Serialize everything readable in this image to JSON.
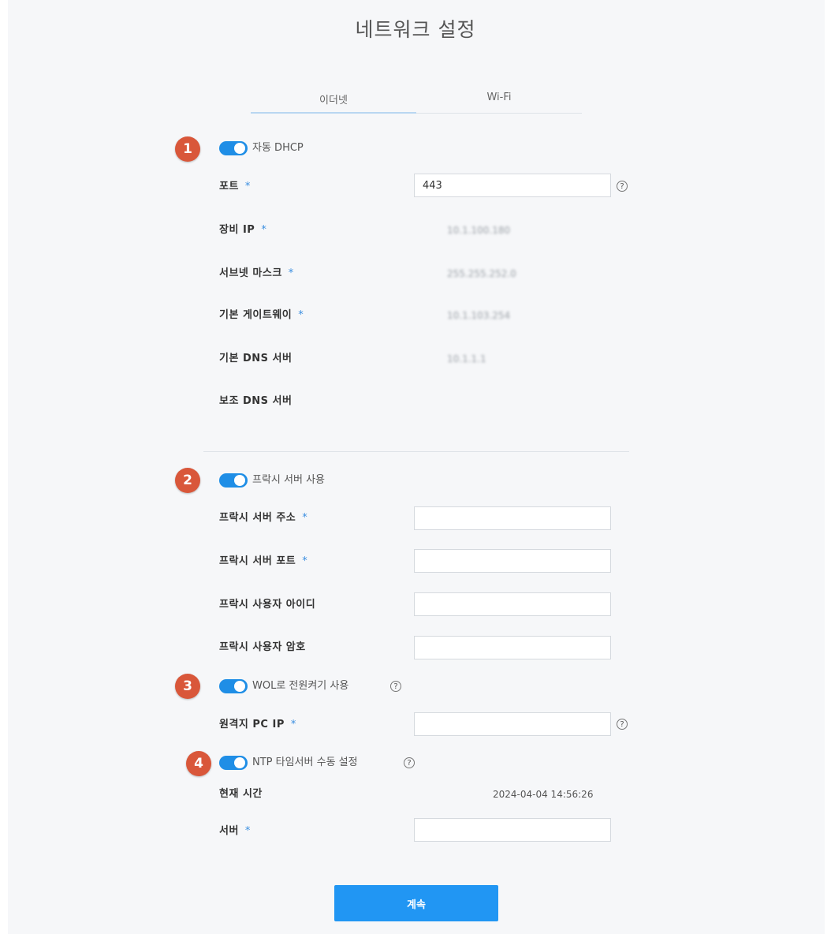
{
  "page_title": "네트워크 설정",
  "tabs": [
    {
      "label": "이더넷",
      "active": true
    },
    {
      "label": "Wi-Fi",
      "active": false
    }
  ],
  "accent_color": "#1f8ee6",
  "badge_color": "#d9573a",
  "required_mark": "*",
  "help_glyph": "?",
  "icons": {
    "help": "question-circle-icon",
    "toggle": "toggle-switch-on"
  },
  "section1": {
    "badge": "1",
    "toggle_label": "자동 DHCP",
    "toggle_on": true,
    "port": {
      "label": "포트",
      "value": "443"
    },
    "device_ip": {
      "label": "장비 IP",
      "value": "10.1.100.180"
    },
    "subnet_mask": {
      "label": "서브넷 마스크",
      "value": "255.255.252.0"
    },
    "gateway": {
      "label": "기본 게이트웨이",
      "value": "10.1.103.254"
    },
    "dns1": {
      "label": "기본 DNS 서버",
      "value": "10.1.1.1"
    },
    "dns2": {
      "label": "보조 DNS 서버",
      "value": ""
    }
  },
  "section2": {
    "badge": "2",
    "toggle_label": "프락시 서버 사용",
    "toggle_on": true,
    "proxy_address": {
      "label": "프락시 서버 주소",
      "value": ""
    },
    "proxy_port": {
      "label": "프락시 서버 포트",
      "value": ""
    },
    "proxy_user": {
      "label": "프락시 사용자 아이디",
      "value": ""
    },
    "proxy_password": {
      "label": "프락시 사용자 암호",
      "value": ""
    }
  },
  "section3": {
    "badge": "3",
    "toggle_label": "WOL로 전원켜기 사용",
    "toggle_on": true,
    "remote_ip": {
      "label": "원격지 PC IP",
      "value": ""
    }
  },
  "section4": {
    "badge": "4",
    "toggle_label": "NTP 타임서버 수동 설정",
    "toggle_on": true,
    "current_time": {
      "label": "현재 시간",
      "value": "2024-04-04 14:56:26"
    },
    "server": {
      "label": "서버",
      "value": ""
    }
  },
  "continue_button": "계속"
}
